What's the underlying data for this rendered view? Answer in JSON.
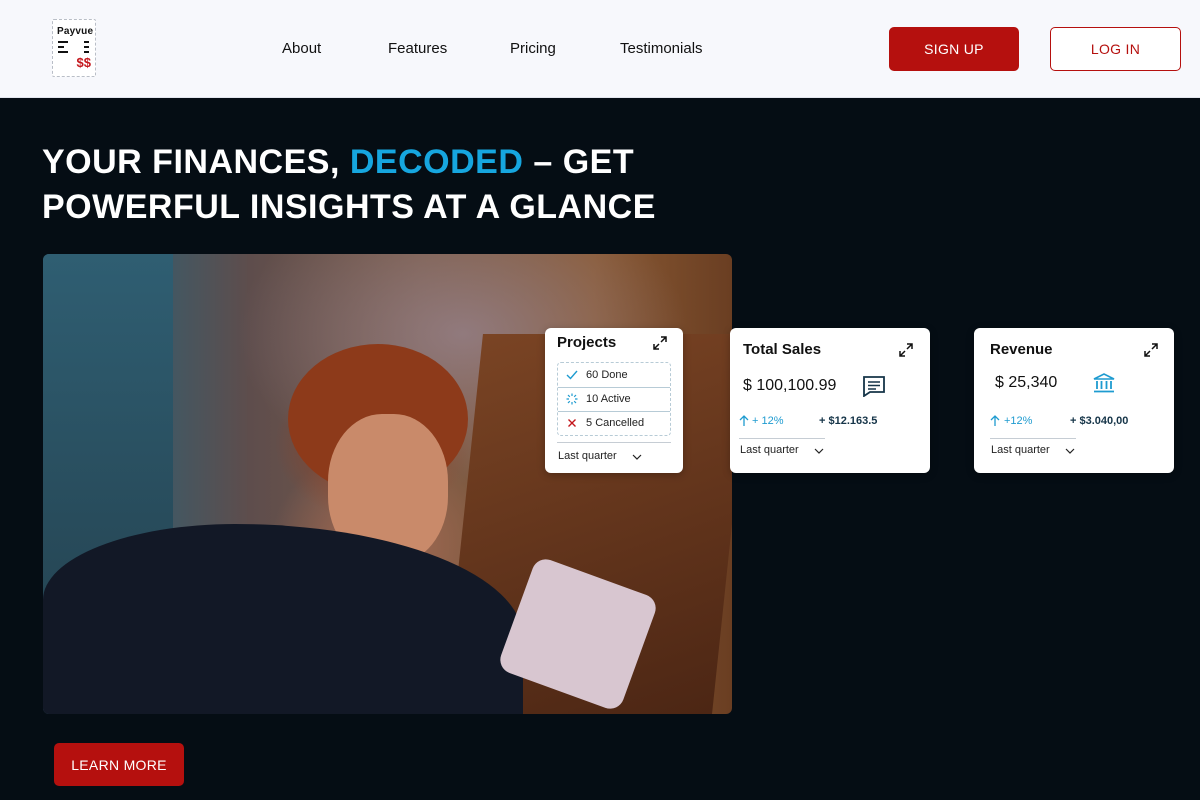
{
  "brand": {
    "name": "Payvue",
    "symbol": "$$"
  },
  "nav": {
    "items": [
      {
        "label": "About"
      },
      {
        "label": "Features"
      },
      {
        "label": "Pricing"
      },
      {
        "label": "Testimonials"
      }
    ],
    "signup_label": "SIGN UP",
    "login_label": "LOG IN"
  },
  "hero": {
    "headline_part1": "YOUR FINANCES, ",
    "headline_accent": "DECODED",
    "headline_part2": " – GET POWERFUL INSIGHTS AT A GLANCE",
    "cta_label": "LEARN MORE"
  },
  "cards": {
    "projects": {
      "title": "Projects",
      "items": [
        {
          "count": "60",
          "label": "Done",
          "icon": "check-icon"
        },
        {
          "count": "10",
          "label": "Active",
          "icon": "loading-icon"
        },
        {
          "count": "5",
          "label": "Cancelled",
          "icon": "x-icon"
        }
      ],
      "period": "Last quarter"
    },
    "sales": {
      "title": "Total Sales",
      "amount": "$ 100,100.99",
      "icon": "receipt-icon",
      "change_pct": "+ 12%",
      "change_value": "+ $12.163.5",
      "period": "Last quarter"
    },
    "revenue": {
      "title": "Revenue",
      "amount": "$ 25,340",
      "icon": "bank-icon",
      "change_pct": "+12%",
      "change_value": "+ $3.040,00",
      "period": "Last quarter"
    }
  },
  "colors": {
    "background": "#050d14",
    "header": "#f7f8fc",
    "primary": "#b5100e",
    "accent": "#16a6df"
  }
}
